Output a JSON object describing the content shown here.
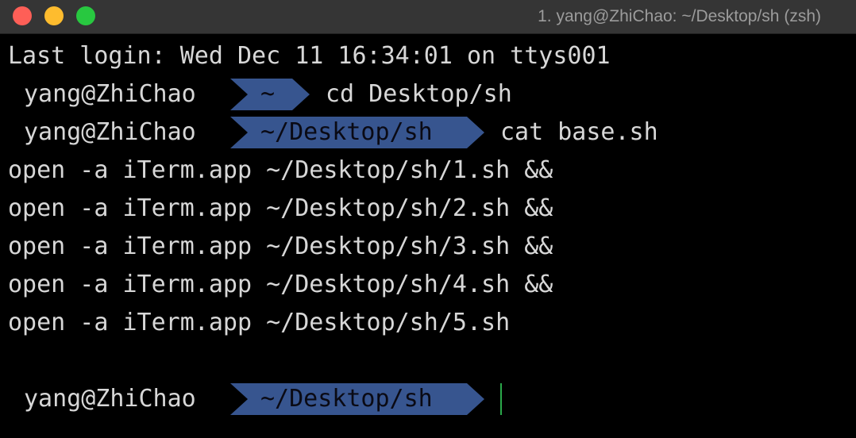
{
  "window": {
    "title": "1. yang@ZhiChao: ~/Desktop/sh (zsh)",
    "traffic_lights": {
      "close_color": "#fe5f57",
      "minimize_color": "#febc2e",
      "zoom_color": "#28c840"
    }
  },
  "theme": {
    "background": "#000000",
    "foreground": "#d7d7d7",
    "prompt_segment_color": "#37558f",
    "cursor_color": "#2aa84a"
  },
  "terminal": {
    "last_login": "Last login: Wed Dec 11 16:34:01 on ttys001",
    "prompts": [
      {
        "user": "yang@ZhiChao",
        "path": "~",
        "command": "cd Desktop/sh"
      },
      {
        "user": "yang@ZhiChao",
        "path": "~/Desktop/sh",
        "command": "cat base.sh"
      },
      {
        "user": "yang@ZhiChao",
        "path": "~/Desktop/sh",
        "command": ""
      }
    ],
    "output": [
      "open -a iTerm.app ~/Desktop/sh/1.sh &&",
      "open -a iTerm.app ~/Desktop/sh/2.sh &&",
      "open -a iTerm.app ~/Desktop/sh/3.sh &&",
      "open -a iTerm.app ~/Desktop/sh/4.sh &&",
      "open -a iTerm.app ~/Desktop/sh/5.sh"
    ]
  }
}
